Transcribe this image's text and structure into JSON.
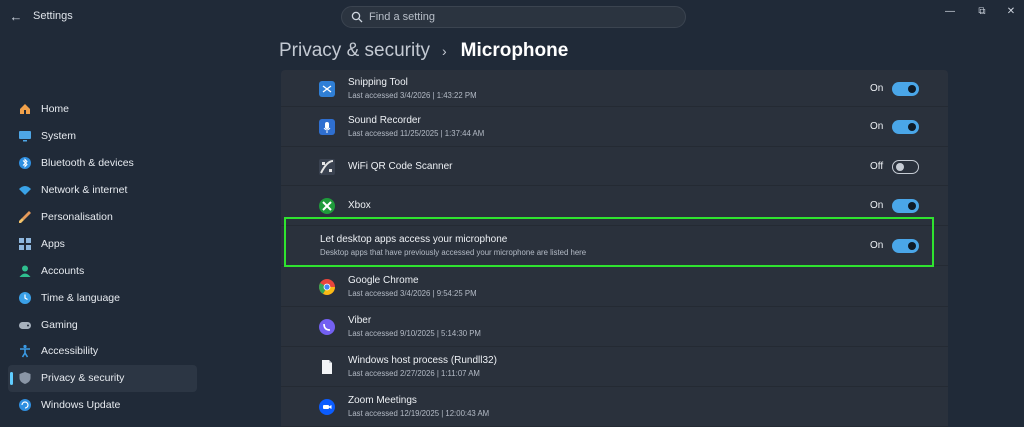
{
  "window": {
    "title": "Settings",
    "back_glyph": "←",
    "minimize_glyph": "—",
    "maximize_glyph": "⧉",
    "close_glyph": "✕"
  },
  "search": {
    "placeholder": "Find a setting",
    "icon": "search-icon"
  },
  "sidebar": {
    "items": [
      {
        "label": "Home",
        "icon": "home-icon",
        "color": "#f2a14a"
      },
      {
        "label": "System",
        "icon": "monitor-icon",
        "color": "#4ea6e6"
      },
      {
        "label": "Bluetooth & devices",
        "icon": "bluetooth-icon",
        "color": "#2f8fe0"
      },
      {
        "label": "Network & internet",
        "icon": "wifi-icon",
        "color": "#3aa3e8"
      },
      {
        "label": "Personalisation",
        "icon": "brush-icon",
        "color": "#e59a5a"
      },
      {
        "label": "Apps",
        "icon": "apps-icon",
        "color": "#8fb7de"
      },
      {
        "label": "Accounts",
        "icon": "person-icon",
        "color": "#2fbf8f"
      },
      {
        "label": "Time & language",
        "icon": "globe-clock-icon",
        "color": "#3aa0e8"
      },
      {
        "label": "Gaming",
        "icon": "gamepad-icon",
        "color": "#a7b1bd"
      },
      {
        "label": "Accessibility",
        "icon": "accessibility-icon",
        "color": "#3a9be6"
      },
      {
        "label": "Privacy & security",
        "icon": "shield-icon",
        "color": "#8a96a6",
        "selected": true
      },
      {
        "label": "Windows Update",
        "icon": "update-icon",
        "color": "#2f8fe0"
      }
    ]
  },
  "header": {
    "parent": "Privacy & security",
    "separator": "›",
    "current": "Microphone"
  },
  "rows": [
    {
      "title": "Snipping Tool",
      "subtitle": "Last accessed 3/4/2026  |  1:43:22 PM",
      "toggle": "On",
      "state": true,
      "icon": "snipping-tool-icon",
      "icon_color": "#2f7fd6"
    },
    {
      "title": "Sound Recorder",
      "subtitle": "Last accessed 11/25/2025  |  1:37:44 AM",
      "toggle": "On",
      "state": true,
      "icon": "sound-recorder-icon",
      "icon_color": "#2f6fd0"
    },
    {
      "title": "WiFi QR Code Scanner",
      "subtitle": "",
      "toggle": "Off",
      "state": false,
      "icon": "qr-scanner-icon",
      "icon_color": "#e6e6e6"
    },
    {
      "title": "Xbox",
      "subtitle": "",
      "toggle": "On",
      "state": true,
      "icon": "xbox-icon",
      "icon_color": "#1f9b3b"
    },
    {
      "title": "Let desktop apps access your microphone",
      "subtitle": "Desktop apps that have previously accessed your microphone are listed here",
      "toggle": "On",
      "state": true,
      "icon": "",
      "icon_color": ""
    },
    {
      "title": "Google Chrome",
      "subtitle": "Last accessed 3/4/2026  |  9:54:25 PM",
      "toggle": "",
      "state": null,
      "icon": "chrome-icon",
      "icon_color": "#e8453c"
    },
    {
      "title": "Viber",
      "subtitle": "Last accessed 9/10/2025  |  5:14:30 PM",
      "toggle": "",
      "state": null,
      "icon": "viber-icon",
      "icon_color": "#7360f2"
    },
    {
      "title": "Windows host process (Rundll32)",
      "subtitle": "Last accessed 2/27/2026  |  1:11:07 AM",
      "toggle": "",
      "state": null,
      "icon": "file-icon",
      "icon_color": "#f2f4f7"
    },
    {
      "title": "Zoom Meetings",
      "subtitle": "Last accessed 12/19/2025  |  12:00:43 AM",
      "toggle": "",
      "state": null,
      "icon": "zoom-icon",
      "icon_color": "#0b5cff"
    }
  ],
  "colors": {
    "accent": "#4aa6e8",
    "highlight": "#2fe32f",
    "background": "#202a38",
    "panel": "#2a313c"
  }
}
